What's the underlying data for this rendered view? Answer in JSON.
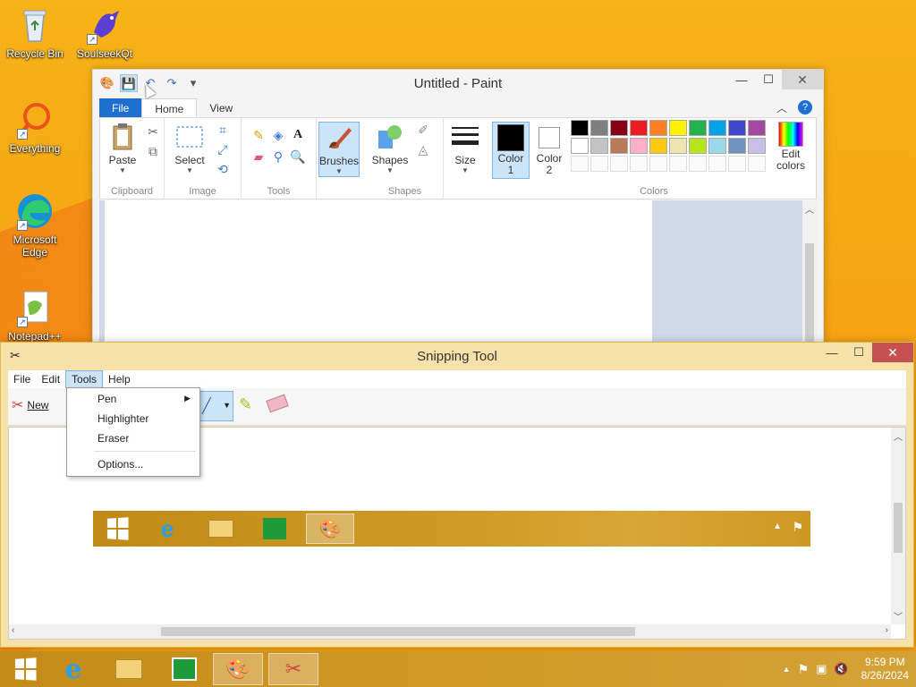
{
  "desktop": {
    "icons": [
      {
        "label": "Recycle Bin"
      },
      {
        "label": "SoulseekQt"
      },
      {
        "label": "Everything"
      },
      {
        "label": "Microsoft Edge"
      },
      {
        "label": "Notepad++"
      }
    ]
  },
  "paint": {
    "title": "Untitled - Paint",
    "tabs": {
      "file": "File",
      "home": "Home",
      "view": "View"
    },
    "help": "?",
    "clipboard": {
      "paste": "Paste",
      "label": "Clipboard"
    },
    "image": {
      "select": "Select",
      "label": "Image"
    },
    "tools": {
      "label": "Tools",
      "text_tool": "A"
    },
    "brushes": {
      "label": "Brushes"
    },
    "shapes": {
      "shapes": "Shapes",
      "label": "Shapes"
    },
    "size": {
      "label": "Size"
    },
    "colors": {
      "color1_label": "Color 1",
      "color2_label": "Color 2",
      "edit_colors": "Edit colors",
      "label": "Colors",
      "color1": "#000000",
      "color2": "#ffffff",
      "palette_row1": [
        "#000000",
        "#7f7f7f",
        "#880015",
        "#ed1c24",
        "#ff7f27",
        "#fff200",
        "#22b14c",
        "#00a2e8",
        "#3f48cc",
        "#a349a4"
      ],
      "palette_row2": [
        "#ffffff",
        "#c3c3c3",
        "#b97a57",
        "#ffaec9",
        "#ffc90e",
        "#efe4b0",
        "#b5e61d",
        "#99d9ea",
        "#7092be",
        "#c8bfe7"
      ]
    }
  },
  "snipping": {
    "title": "Snipping Tool",
    "menu": {
      "file": "File",
      "edit": "Edit",
      "tools": "Tools",
      "help": "Help"
    },
    "new_label": "New",
    "dropdown": {
      "pen": "Pen",
      "highlighter": "Highlighter",
      "eraser": "Eraser",
      "options": "Options..."
    }
  },
  "taskbar": {
    "time": "9:59 PM",
    "date": "8/26/2024"
  },
  "colors": {
    "accent": "#1e6fd0",
    "close_red": "#c75050",
    "taskbar": "#c48a1a"
  }
}
